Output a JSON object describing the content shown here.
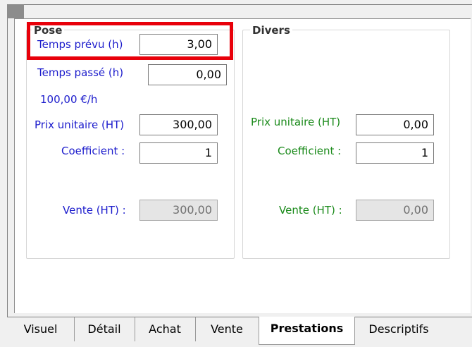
{
  "pose": {
    "legend": "Pose",
    "temps_prevu_label": "Temps prévu (h)",
    "temps_prevu_value": "3,00",
    "temps_passe_label": "Temps passé (h)",
    "temps_passe_value": "0,00",
    "taux_horaire": "100,00 €/h",
    "prix_unitaire_label": "Prix unitaire (HT)",
    "prix_unitaire_value": "300,00",
    "coefficient_label": "Coefficient :",
    "coefficient_value": "1",
    "vente_label": "Vente (HT) :",
    "vente_value": "300,00"
  },
  "divers": {
    "legend": "Divers",
    "prix_unitaire_label": "Prix unitaire (HT)",
    "prix_unitaire_value": "0,00",
    "coefficient_label": "Coefficient :",
    "coefficient_value": "1",
    "vente_label": "Vente (HT) :",
    "vente_value": "0,00"
  },
  "tabs": [
    {
      "label": "Visuel"
    },
    {
      "label": "Détail"
    },
    {
      "label": "Achat"
    },
    {
      "label": "Vente"
    },
    {
      "label": "Prestations",
      "active": true
    },
    {
      "label": "Descriptifs"
    }
  ],
  "colors": {
    "pose_label": "#1c1ccc",
    "divers_label": "#1a8a1a",
    "highlight": "#e8000a"
  }
}
